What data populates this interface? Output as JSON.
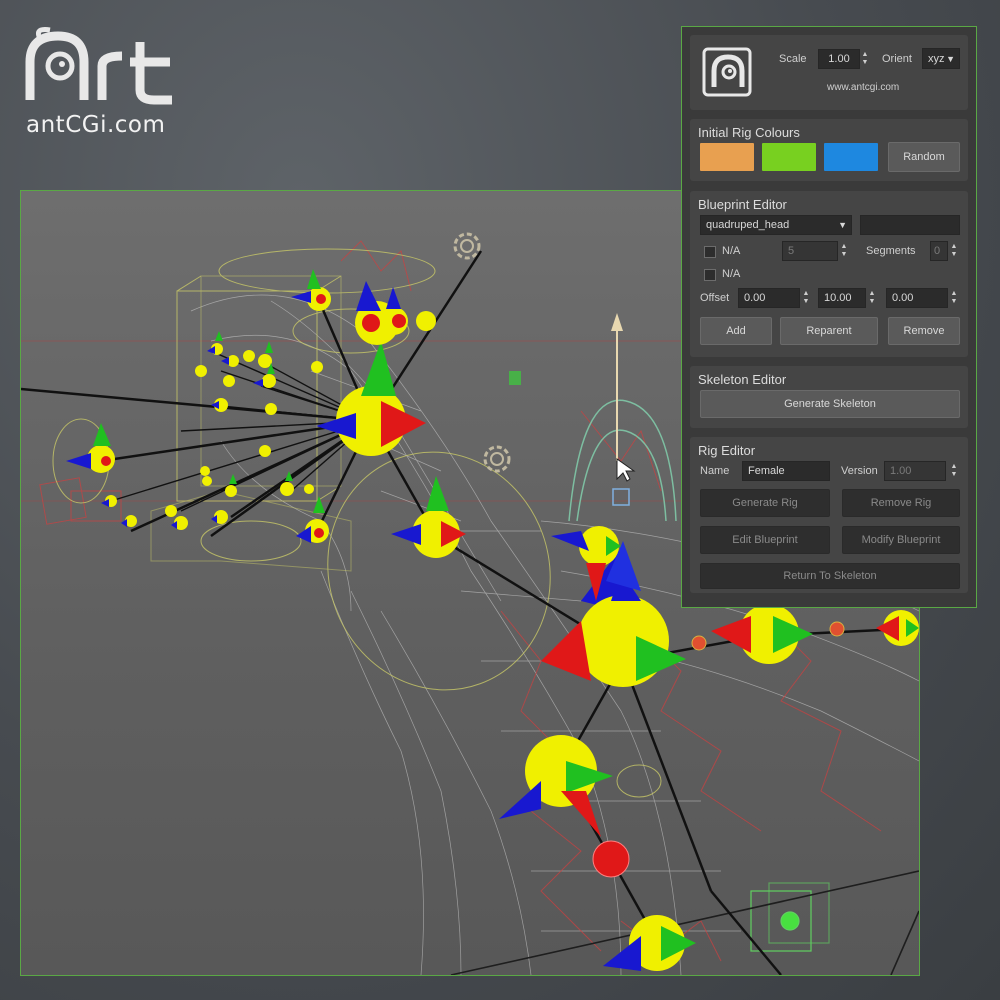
{
  "logo": {
    "mark": "Art",
    "url": "antCGi.com"
  },
  "panel": {
    "scale_label": "Scale",
    "scale_value": "1.00",
    "orient_label": "Orient",
    "orient_value": "xyz",
    "website": "www.antcgi.com",
    "rig_colours": {
      "title": "Initial Rig Colours",
      "colors": [
        "#e8a050",
        "#78d020",
        "#1e88e0"
      ],
      "random_label": "Random"
    },
    "blueprint": {
      "title": "Blueprint Editor",
      "module_value": "quadruped_head",
      "na1_label": "N/A",
      "na1_value": "5",
      "segments_label": "Segments",
      "segments_value": "0",
      "na2_label": "N/A",
      "offset_label": "Offset",
      "offset_x": "0.00",
      "offset_y": "10.00",
      "offset_z": "0.00",
      "add_label": "Add",
      "reparent_label": "Reparent",
      "remove_label": "Remove"
    },
    "skeleton": {
      "title": "Skeleton Editor",
      "generate_label": "Generate Skeleton"
    },
    "rig": {
      "title": "Rig Editor",
      "name_label": "Name",
      "name_value": "Female",
      "version_label": "Version",
      "version_value": "1.00",
      "generate_rig_label": "Generate Rig",
      "remove_rig_label": "Remove Rig",
      "edit_blueprint_label": "Edit Blueprint",
      "modify_blueprint_label": "Modify Blueprint",
      "return_label": "Return To Skeleton"
    }
  }
}
